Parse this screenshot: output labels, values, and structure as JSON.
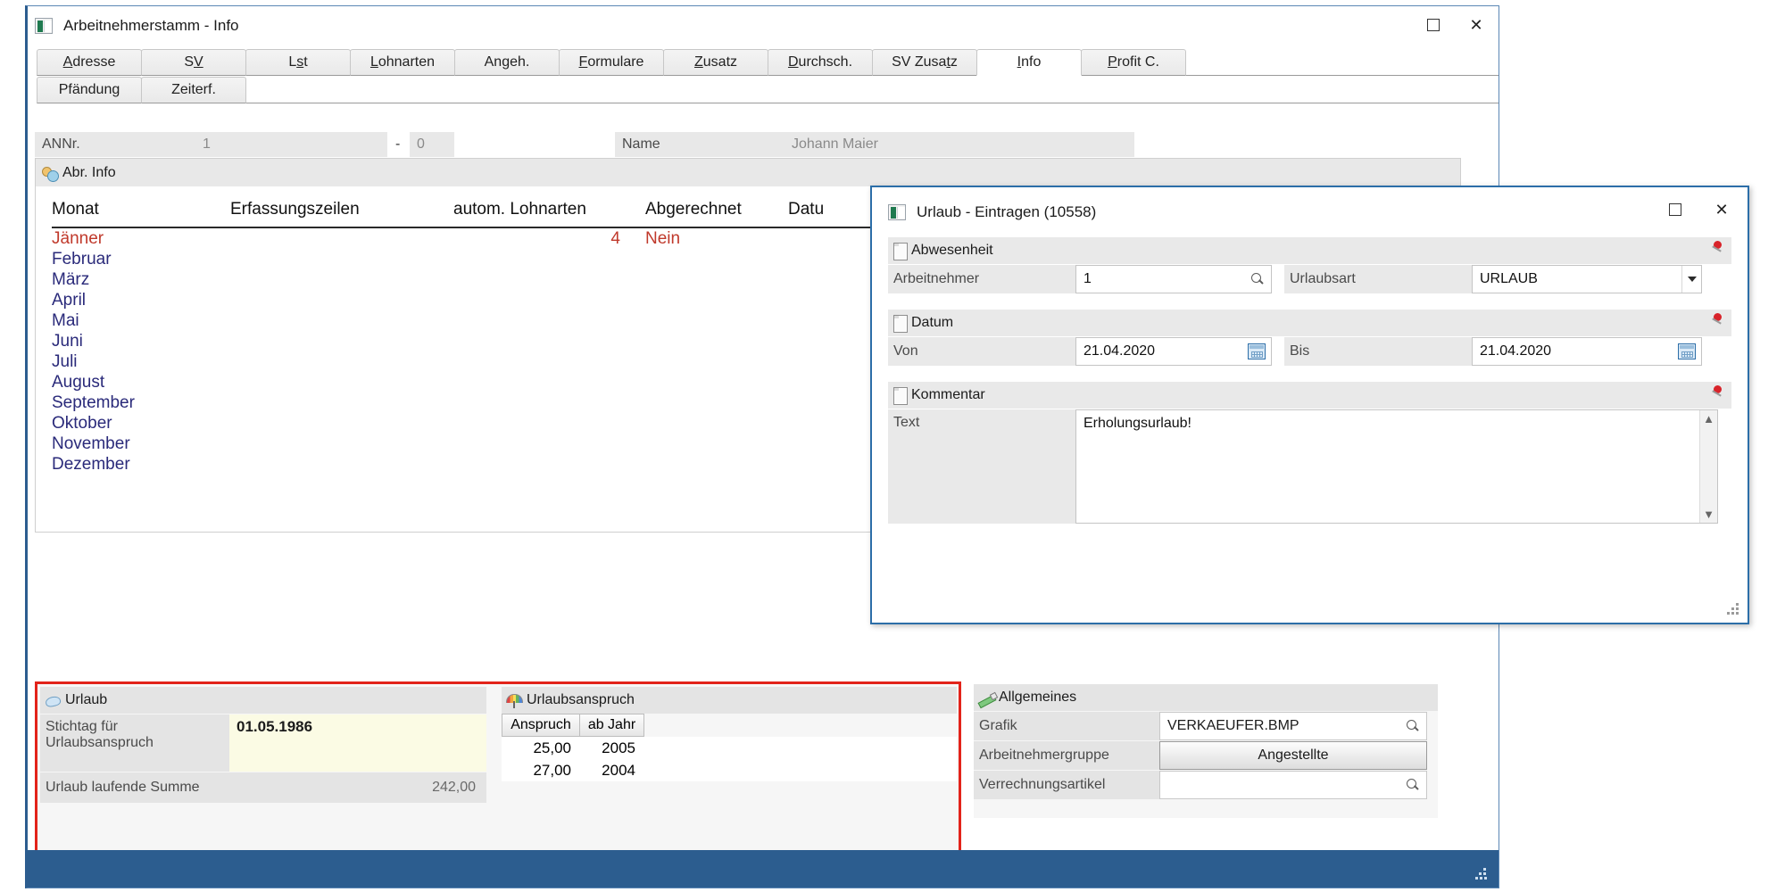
{
  "main_window": {
    "title": "Arbeitnehmerstamm - Info",
    "icon": "app-icon",
    "buttons": {
      "maximize": "maximize-icon",
      "close": "✕"
    },
    "tabs_row1": [
      {
        "label": "Adresse",
        "accel": "A"
      },
      {
        "label": "SV",
        "accel": "V"
      },
      {
        "label": "Lst",
        "accel": "s"
      },
      {
        "label": "Lohnarten",
        "accel": "L"
      },
      {
        "label": "Angeh.",
        "accel": "g"
      },
      {
        "label": "Formulare",
        "accel": "F"
      },
      {
        "label": "Zusatz",
        "accel": "Z"
      },
      {
        "label": "Durchsch.",
        "accel": "D"
      },
      {
        "label": "SV Zusatz",
        "accel": "t"
      },
      {
        "label": "Info",
        "accel": "I",
        "active": true
      },
      {
        "label": "Profit C.",
        "accel": "P"
      }
    ],
    "tabs_row2": [
      {
        "label": "Pfändung",
        "accel": ""
      },
      {
        "label": "Zeiterf.",
        "accel": ""
      }
    ],
    "fields": {
      "annr_label": "ANNr.",
      "annr_value": "1",
      "annr_separator": "-",
      "annr_sub": "0",
      "name_label": "Name",
      "name_value": "Johann Maier"
    },
    "abr_info": {
      "title": "Abr. Info",
      "icon": "people-icon",
      "columns": [
        "Monat",
        "Erfassungszeilen",
        "autom. Lohnarten",
        "Abgerechnet",
        "Datu"
      ],
      "rows": [
        {
          "monat": "Jänner",
          "erfassungszeilen": "",
          "autom_lohnarten": "4",
          "abgerechnet": "Nein",
          "datum": "",
          "highlight": true
        },
        {
          "monat": "Februar",
          "erfassungszeilen": "",
          "autom_lohnarten": "",
          "abgerechnet": "",
          "datum": ""
        },
        {
          "monat": "März",
          "erfassungszeilen": "",
          "autom_lohnarten": "",
          "abgerechnet": "",
          "datum": ""
        },
        {
          "monat": "April",
          "erfassungszeilen": "",
          "autom_lohnarten": "",
          "abgerechnet": "",
          "datum": ""
        },
        {
          "monat": "Mai",
          "erfassungszeilen": "",
          "autom_lohnarten": "",
          "abgerechnet": "",
          "datum": ""
        },
        {
          "monat": "Juni",
          "erfassungszeilen": "",
          "autom_lohnarten": "",
          "abgerechnet": "",
          "datum": ""
        },
        {
          "monat": "Juli",
          "erfassungszeilen": "",
          "autom_lohnarten": "",
          "abgerechnet": "",
          "datum": ""
        },
        {
          "monat": "August",
          "erfassungszeilen": "",
          "autom_lohnarten": "",
          "abgerechnet": "",
          "datum": ""
        },
        {
          "monat": "September",
          "erfassungszeilen": "",
          "autom_lohnarten": "",
          "abgerechnet": "",
          "datum": ""
        },
        {
          "monat": "Oktober",
          "erfassungszeilen": "",
          "autom_lohnarten": "",
          "abgerechnet": "",
          "datum": ""
        },
        {
          "monat": "November",
          "erfassungszeilen": "",
          "autom_lohnarten": "",
          "abgerechnet": "",
          "datum": ""
        },
        {
          "monat": "Dezember",
          "erfassungszeilen": "",
          "autom_lohnarten": "",
          "abgerechnet": "",
          "datum": ""
        }
      ]
    },
    "urlaub_panel": {
      "title": "Urlaub",
      "icon": "hand-icon",
      "stichtag_label_line1": "Stichtag für",
      "stichtag_label_line2": "Urlaubsanspruch",
      "stichtag_value": "01.05.1986",
      "summe_label": "Urlaub laufende Summe",
      "summe_value": "242,00"
    },
    "urlaubsanspruch_panel": {
      "title": "Urlaubsanspruch",
      "icon": "umbrella-icon",
      "columns": [
        "Anspruch",
        "ab Jahr"
      ],
      "rows": [
        {
          "anspruch": "25,00",
          "ab_jahr": "2005"
        },
        {
          "anspruch": "27,00",
          "ab_jahr": "2004"
        }
      ]
    },
    "allgemeines_panel": {
      "title": "Allgemeines",
      "icon": "pencil-icon",
      "grafik_label": "Grafik",
      "grafik_value": "VERKAEUFER.BMP",
      "gruppe_label": "Arbeitnehmergruppe",
      "gruppe_value": "Angestellte",
      "verrechnung_label": "Verrechnungsartikel",
      "verrechnung_value": ""
    }
  },
  "dialog": {
    "title": "Urlaub - Eintragen (10558)",
    "icon": "app-icon",
    "buttons": {
      "maximize": "maximize-icon",
      "close": "✕"
    },
    "sections": {
      "abwesenheit": {
        "title": "Abwesenheit",
        "pin": "pin-icon",
        "arbeitnehmer_label": "Arbeitnehmer",
        "arbeitnehmer_value": "1",
        "arbeitnehmer_adorn": "search-icon",
        "urlaubsart_label": "Urlaubsart",
        "urlaubsart_value": "URLAUB",
        "urlaubsart_adorn": "chevron-down-icon"
      },
      "datum": {
        "title": "Datum",
        "pin": "pin-icon",
        "von_label": "Von",
        "von_value": "21.04.2020",
        "bis_label": "Bis",
        "bis_value": "21.04.2020",
        "adorn": "calendar-icon"
      },
      "kommentar": {
        "title": "Kommentar",
        "pin": "pin-icon",
        "text_label": "Text",
        "text_value": "Erholungsurlaub!",
        "scroll_up": "▲",
        "scroll_down": "▼"
      }
    }
  },
  "colors": {
    "window_border": "#2c5d8f",
    "dialog_border": "#2c6ea8",
    "highlight_red": "#c0392b",
    "redbox": "#e2231a",
    "month_blue": "#2a2a7a",
    "statusbar": "#2c5d8f"
  }
}
